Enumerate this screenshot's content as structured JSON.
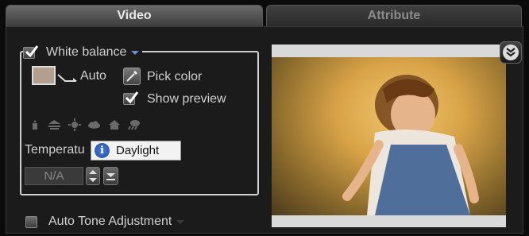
{
  "tabs": [
    {
      "label": "Video",
      "active": true
    },
    {
      "label": "Attribute",
      "active": false
    }
  ],
  "white_balance": {
    "label": "White balance",
    "checked": true,
    "auto_label": "Auto",
    "pick_color_label": "Pick color",
    "show_preview_label": "Show preview",
    "show_preview_checked": true,
    "swatch_color": "#b39f8e",
    "presets": [
      "candle-icon",
      "fluorescent-icon",
      "sun-icon",
      "cloudy-icon",
      "shade-icon",
      "overcast-icon"
    ],
    "temperature_label": "Temperatu",
    "temperature_value": "N/A"
  },
  "tooltip": {
    "text": "Daylight"
  },
  "auto_tone": {
    "label": "Auto Tone Adjustment",
    "checked": false
  },
  "colors": {
    "accent": "#6b8fd6",
    "info": "#2a5fc2"
  }
}
